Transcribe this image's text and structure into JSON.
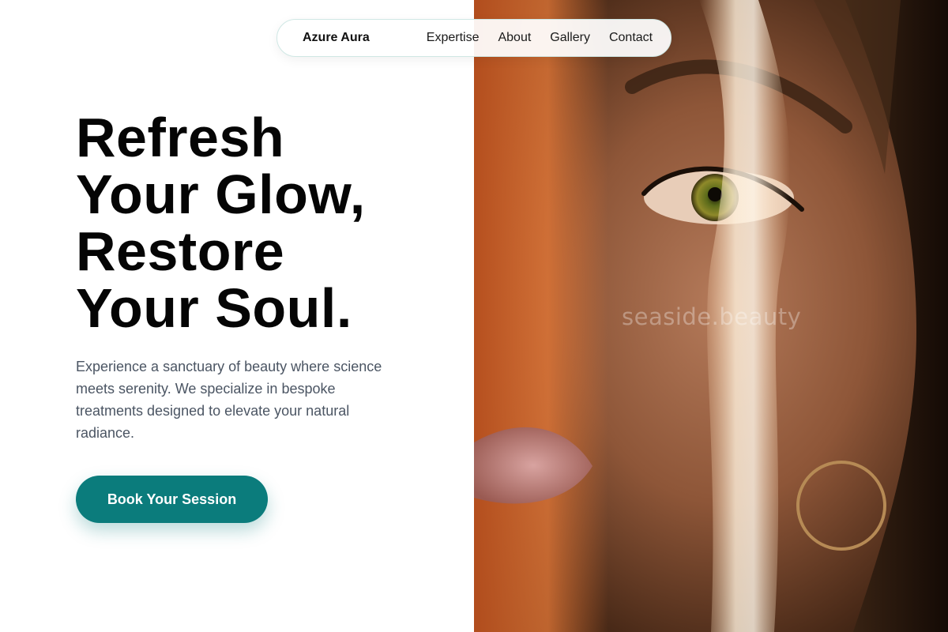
{
  "nav": {
    "brand": "Azure Aura",
    "links": [
      {
        "label": "Expertise"
      },
      {
        "label": "About"
      },
      {
        "label": "Gallery"
      },
      {
        "label": "Contact"
      }
    ]
  },
  "hero": {
    "headline_lines": [
      "Refresh",
      "Your Glow,",
      "Restore",
      "Your Soul."
    ],
    "lead": "Experience a sanctuary of beauty where science meets serenity. We specialize in bespoke treatments designed to elevate your natural radiance.",
    "cta_label": "Book Your Session"
  },
  "photo": {
    "watermark": "seaside.beauty"
  },
  "colors": {
    "accent": "#0b7c7c",
    "headline": "#050505",
    "body_text": "#4b5563"
  }
}
